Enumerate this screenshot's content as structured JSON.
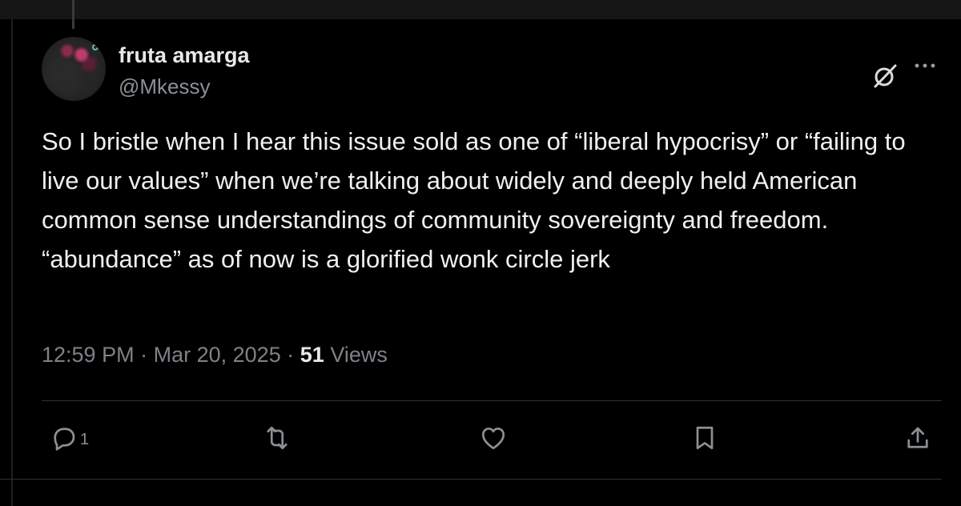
{
  "author": {
    "display_name": "fruta amarga",
    "handle": "@Mkessy"
  },
  "tweet": {
    "text": "So I bristle when I hear this issue sold as one of “liberal hypocrisy” or “failing to live our values” when we’re talking about widely and deeply held American common sense understandings of community sovereignty and freedom. “abundance” as of now is a glorified wonk circle jerk",
    "time": "12:59 PM",
    "date": "Mar 20, 2025",
    "separator": "·",
    "views_count": "51",
    "views_label": "Views"
  },
  "actions": {
    "reply_count": "1",
    "icons": [
      "reply-icon",
      "retweet-icon",
      "like-icon",
      "bookmark-icon",
      "share-icon"
    ]
  },
  "header_icons": [
    "grok-icon",
    "more-icon"
  ],
  "colors": {
    "background": "#000000",
    "text": "#e7e9ea",
    "muted": "#8b9095",
    "divider": "#2f3336"
  }
}
